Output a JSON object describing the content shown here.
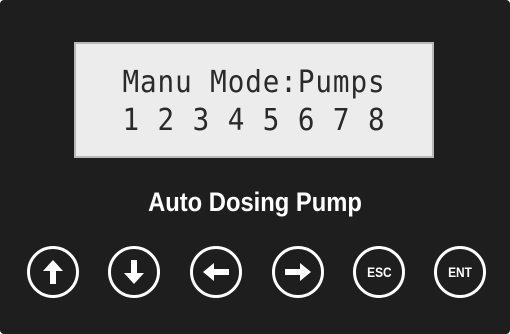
{
  "lcd": {
    "line1": "Manu Mode:Pumps",
    "line2": "1 2 3 4 5 6 7 8"
  },
  "device": {
    "name": "Auto Dosing Pump"
  },
  "keys": [
    {
      "icon": "arrow-up-icon"
    },
    {
      "icon": "arrow-down-icon"
    },
    {
      "icon": "arrow-left-icon"
    },
    {
      "icon": "arrow-right-icon"
    },
    {
      "label": "ESC"
    },
    {
      "label": "ENT"
    }
  ],
  "colors": {
    "panel": "#1e1e1e",
    "lcd_background": "#ececec",
    "lcd_text": "#2a2a2a",
    "key_outline": "#ffffff"
  }
}
